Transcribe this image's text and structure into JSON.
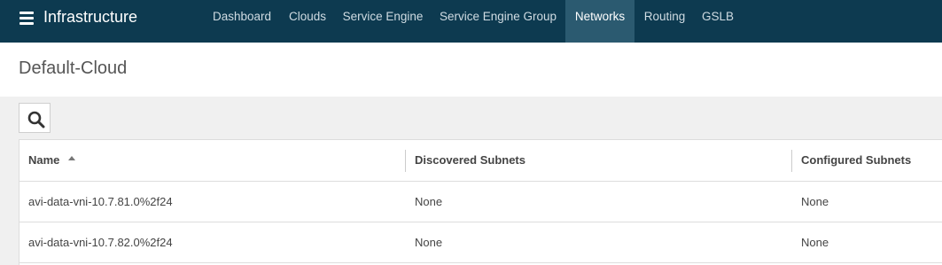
{
  "header": {
    "app_title": "Infrastructure",
    "menu_icon": "hamburger-menu-icon",
    "tabs": [
      {
        "label": "Dashboard",
        "active": false
      },
      {
        "label": "Clouds",
        "active": false
      },
      {
        "label": "Service Engine",
        "active": false
      },
      {
        "label": "Service Engine Group",
        "active": false
      },
      {
        "label": "Networks",
        "active": true
      },
      {
        "label": "Routing",
        "active": false
      },
      {
        "label": "GSLB",
        "active": false
      }
    ]
  },
  "page": {
    "title": "Default-Cloud",
    "search_icon": "search-icon"
  },
  "table": {
    "columns": [
      "Name",
      "Discovered Subnets",
      "Configured Subnets"
    ],
    "sort": {
      "column": "Name",
      "direction": "ascending"
    },
    "rows": [
      {
        "name": "avi-data-vni-10.7.81.0%2f24",
        "discovered": "None",
        "configured": "None"
      },
      {
        "name": "avi-data-vni-10.7.82.0%2f24",
        "discovered": "None",
        "configured": "None"
      }
    ]
  },
  "colors": {
    "topbar": "#0d3a50",
    "active_tab": "#2b5a70",
    "page_background": "#f0f0f0"
  }
}
